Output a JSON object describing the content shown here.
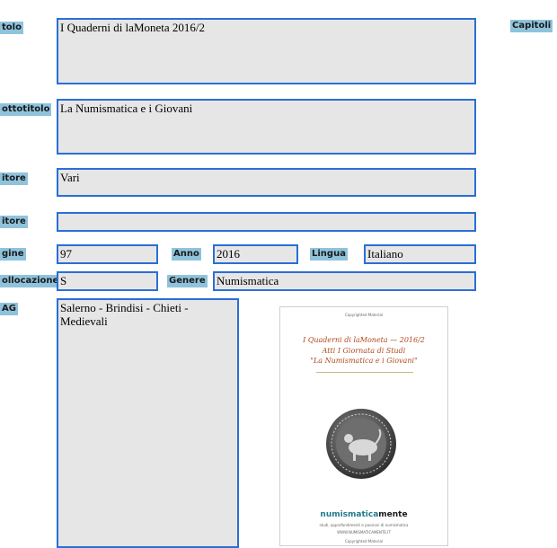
{
  "labels": {
    "titolo": "tolo",
    "sottotitolo": "ottotitolo",
    "autore": "itore",
    "editore": "itore",
    "pagine": "gine",
    "anno": "Anno",
    "lingua": "Lingua",
    "collocazione": "ollocazione",
    "genere": "Genere",
    "tag": "AG",
    "capitoli": "Capitoli"
  },
  "fields": {
    "titolo": "I Quaderni di laMoneta   2016/2",
    "sottotitolo": "La Numismatica e i Giovani",
    "autore": "Vari",
    "editore": "",
    "pagine": "97",
    "anno": "2016",
    "lingua": "Italiano",
    "collocazione": "S",
    "genere": "Numismatica",
    "tag": "Salerno - Brindisi - Chieti - Medievali"
  },
  "cover": {
    "top_note": "Copyrighted Material",
    "title_line1": "I Quaderni di laMoneta — 2016/2",
    "title_line2": "Atti I Giornata di Studi",
    "title_line3": "\"La Numismatica e i Giovani\"",
    "brand_part1": "numismatica",
    "brand_part2": "mente",
    "tagline": "studi, approfondimenti e passioni di numismatica",
    "website": "WWW.NUMISMATICAMENTE.IT",
    "bottom_note": "Copyrighted Material"
  },
  "colors": {
    "label_bg": "#8fc3dc",
    "field_bg": "#e6e6e6",
    "field_border": "#2a6fd6"
  }
}
